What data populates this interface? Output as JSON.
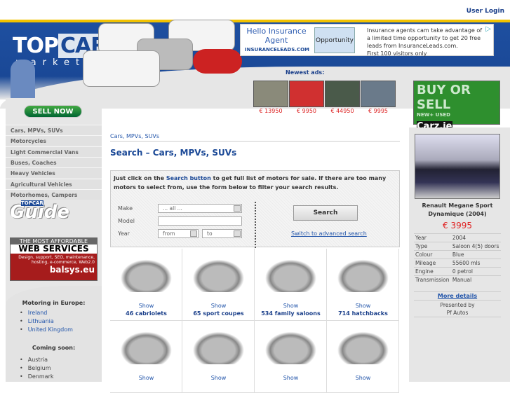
{
  "header": {
    "user_login": "User Login",
    "logo_top": "TOP",
    "logo_car": "CAR",
    "logo_sub": "market",
    "sell_now": "SELL NOW"
  },
  "ad": {
    "headline": "Hello Insurance Agent",
    "brand": "INSURANCELEADS.COM",
    "badge": "Opportunity",
    "text": "Insurance agents cam take advantage of a limited time opportunity to get 20 free leads from InsuranceLeads.com.",
    "text2": "First 100 visitors only"
  },
  "newest": {
    "label": "Newest ads:",
    "prices": [
      "€ 13950",
      "€ 9950",
      "€ 44950",
      "€ 9995"
    ],
    "colors": [
      "#8a8a7a",
      "#d03030",
      "#4a5a4a",
      "#6a7a8a"
    ]
  },
  "banner_right": {
    "text": "BUY OR SELL",
    "sub": "NEW+ USED",
    "brand": "Carz.ie"
  },
  "sidebar": {
    "nav": [
      "Cars, MPVs, SUVs",
      "Motorcycles",
      "Light Commercial Vans",
      "Buses, Coaches",
      "Heavy Vehicles",
      "Agricultural Vehicles",
      "Motorhomes, Campers"
    ],
    "guide": "Guide",
    "guide_brand": "TOPCAR",
    "webservices": {
      "line1": "THE MOST AFFORDABLE",
      "line2": "WEB SERVICES",
      "line3": "Design, support, SEO, maintenance, hosting, e-commerce, Web2.0",
      "brand": "balsys.eu"
    },
    "europe_title": "Motoring in Europe:",
    "europe": [
      "Ireland",
      "Lithuania",
      "United Kingdom"
    ],
    "soon_title": "Coming soon:",
    "soon": [
      "Austria",
      "Belgium",
      "Denmark"
    ]
  },
  "main": {
    "breadcrumb": "Cars, MPVs, SUVs",
    "title": "Search – Cars, MPVs, SUVs",
    "intro_a": "Just click on the ",
    "intro_link": "Search button",
    "intro_b": " to get full list of motors for sale. If there are too many motors to select from, use the form below to filter your search results.",
    "form": {
      "make_label": "Make",
      "make_value": "... all ...",
      "model_label": "Model",
      "model_value": "",
      "year_label": "Year",
      "year_from": "from",
      "year_to": "to",
      "search": "Search",
      "advanced": "Switch to advanced search"
    },
    "categories": [
      {
        "show": "Show",
        "name": "46 cabriolets"
      },
      {
        "show": "Show",
        "name": "65 sport coupes"
      },
      {
        "show": "Show",
        "name": "534 family saloons"
      },
      {
        "show": "Show",
        "name": "714 hatchbacks"
      },
      {
        "show": "Show",
        "name": ""
      },
      {
        "show": "Show",
        "name": ""
      },
      {
        "show": "Show",
        "name": ""
      },
      {
        "show": "Show",
        "name": ""
      }
    ]
  },
  "featured": {
    "name": "Renault Megane Sport Dynamique (2004)",
    "price": "€ 3995",
    "specs": [
      [
        "Year",
        "2004"
      ],
      [
        "Type",
        "Saloon 4(5) doors"
      ],
      [
        "Colour",
        "Blue"
      ],
      [
        "Mileage",
        "55600 mls"
      ],
      [
        "Engine",
        "0 petrol"
      ],
      [
        "Transmission",
        "Manual"
      ]
    ],
    "more": "More details",
    "presented": "Presented by",
    "dealer": "Pf Autos"
  }
}
